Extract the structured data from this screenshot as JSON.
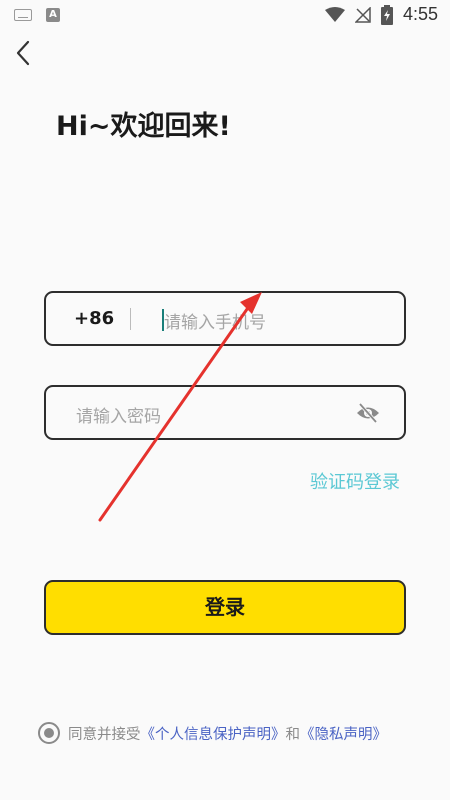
{
  "status_bar": {
    "time": "4:55",
    "icons": [
      "keyboard-icon",
      "a-notification-icon",
      "wifi-icon",
      "no-signal-icon",
      "battery-charging-icon"
    ]
  },
  "header": {
    "back_icon": "chevron-left-icon",
    "greeting": "Hi~欢迎回来!"
  },
  "form": {
    "country_code": "+86",
    "phone_placeholder": "请输入手机号",
    "password_placeholder": "请输入密码",
    "visibility_icon": "eye-off-icon",
    "sms_login_label": "验证码登录",
    "login_button_label": "登录"
  },
  "agreement": {
    "prefix": "同意并接受",
    "privacy_protection_link": "《个人信息保护声明》",
    "conjunction": "和",
    "privacy_link": "《隐私声明》"
  },
  "colors": {
    "accent_yellow": "#ffde00",
    "link_cyan": "#5bc8d4",
    "link_blue": "#4a63c4",
    "annotation_red": "#e5322d"
  }
}
